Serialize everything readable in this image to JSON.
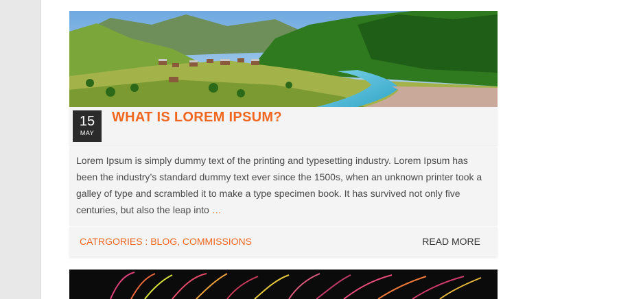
{
  "post": {
    "date_day": "15",
    "date_month": "MAY",
    "title": "WHAT IS LOREM IPSUM?",
    "excerpt": "Lorem Ipsum is simply dummy text of the printing and typesetting industry. Lorem Ipsum has been the industry’s standard dummy text ever since the 1500s, when an unknown printer took a galley of type and scrambled it to make a type specimen book. It has survived not only five centuries, but also the leap into",
    "ellipsis": "…",
    "categories_prefix": "CATRGORIES : ",
    "categories": [
      "BLOG",
      "COMMISSIONS"
    ],
    "read_more": "READ MORE"
  },
  "colors": {
    "accent": "#f0661e",
    "badge_bg": "#2b2b2b",
    "card_bg": "#f4f4f4"
  }
}
